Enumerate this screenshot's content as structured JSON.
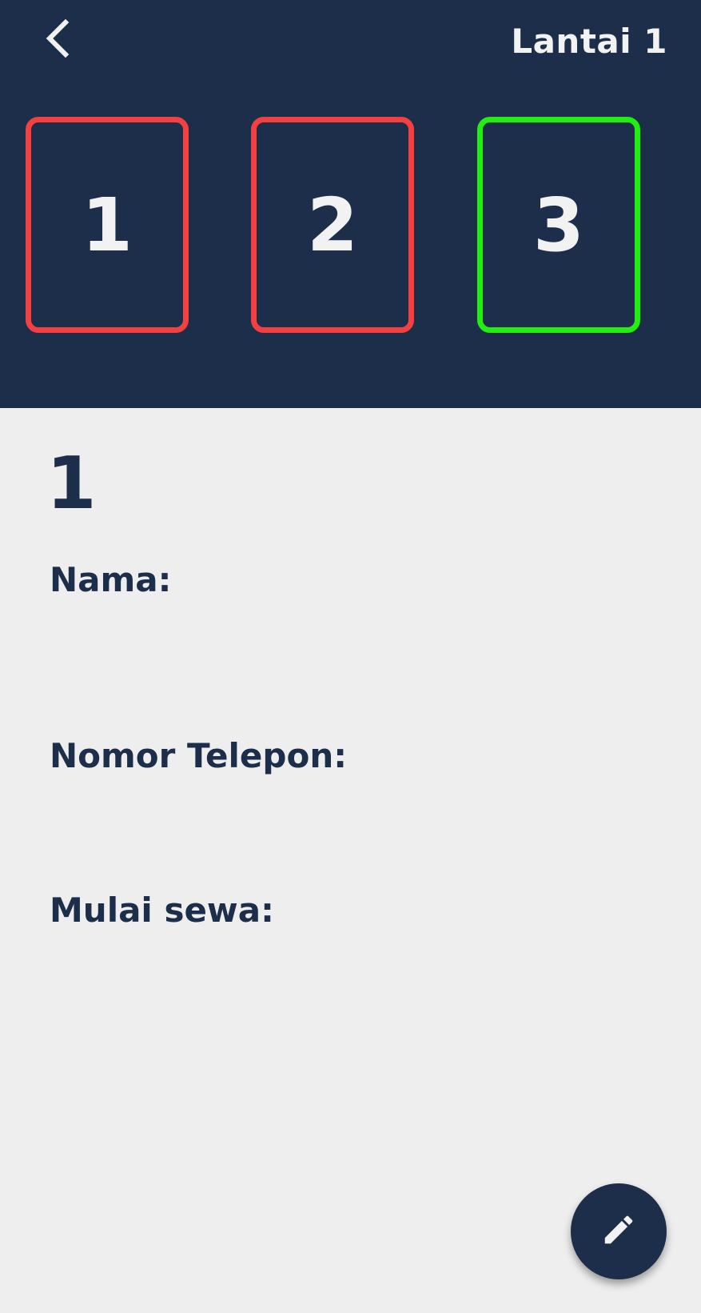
{
  "header": {
    "title": "Lantai 1",
    "back_icon": "chevron-left-icon",
    "background_color": "#1c2e4a"
  },
  "rooms": [
    {
      "label": "1",
      "status": "occupied",
      "color": "#f44040"
    },
    {
      "label": "2",
      "status": "occupied",
      "color": "#f44040"
    },
    {
      "label": "3",
      "status": "available",
      "color": "#22ee11"
    }
  ],
  "detail": {
    "room_number": "1",
    "fields": {
      "name": {
        "label": "Nama:",
        "value": ""
      },
      "phone": {
        "label": "Nomor Telepon:",
        "value": ""
      },
      "start": {
        "label": "Mulai sewa:",
        "value": ""
      }
    }
  },
  "fab": {
    "icon": "pencil-icon"
  }
}
